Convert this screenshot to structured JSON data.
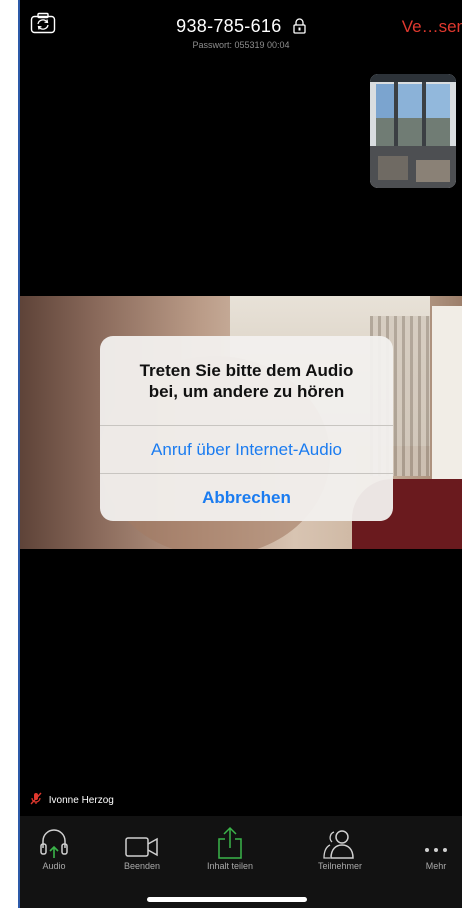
{
  "header": {
    "meeting_id": "938-785-616",
    "password_line": "Passwort: 055319  00:04",
    "leave_label": "Ve…sen"
  },
  "dialog": {
    "title_line1": "Treten Sie bitte dem Audio",
    "title_line2": "bei, um andere zu hören",
    "internet_audio_label": "Anruf über Internet-Audio",
    "cancel_label": "Abbrechen"
  },
  "participant": {
    "name": "Ivonne Herzog"
  },
  "toolbar": {
    "items": [
      {
        "label": "Audio",
        "icon": "headphones-icon"
      },
      {
        "label": "Beenden",
        "icon": "video-camera-icon"
      },
      {
        "label": "Inhalt teilen",
        "icon": "share-upload-icon"
      },
      {
        "label": "Teilnehmer",
        "icon": "participants-icon"
      },
      {
        "label": "Mehr",
        "icon": "more-dots-icon"
      }
    ]
  },
  "colors": {
    "accent_blue": "#1b7cf0",
    "leave_red": "#e0382e",
    "share_green": "#3bb54a",
    "background": "#000000"
  }
}
